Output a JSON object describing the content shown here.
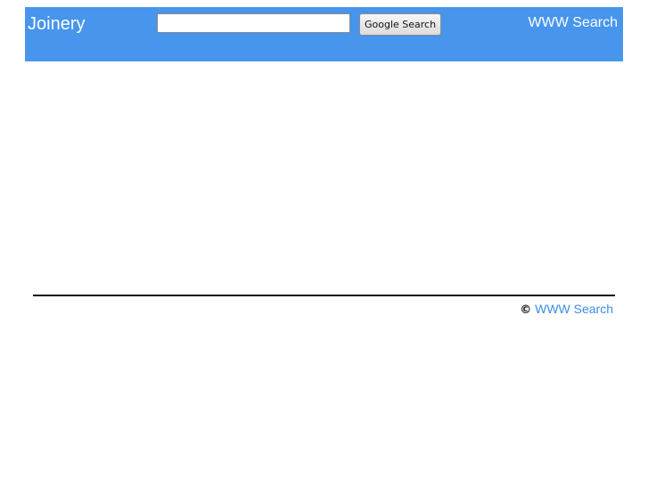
{
  "header": {
    "site_title": "Joinery",
    "search": {
      "value": "",
      "placeholder": "",
      "button_label": "Google Search"
    },
    "right_link": "WWW Search"
  },
  "footer": {
    "copyright_symbol": "©",
    "link_text": "WWW Search"
  },
  "colors": {
    "header_background": "#4795ec",
    "link": "#3a8ee6",
    "header_text": "#ffffff"
  },
  "icons": {
    "copyright": "copyright-icon"
  }
}
